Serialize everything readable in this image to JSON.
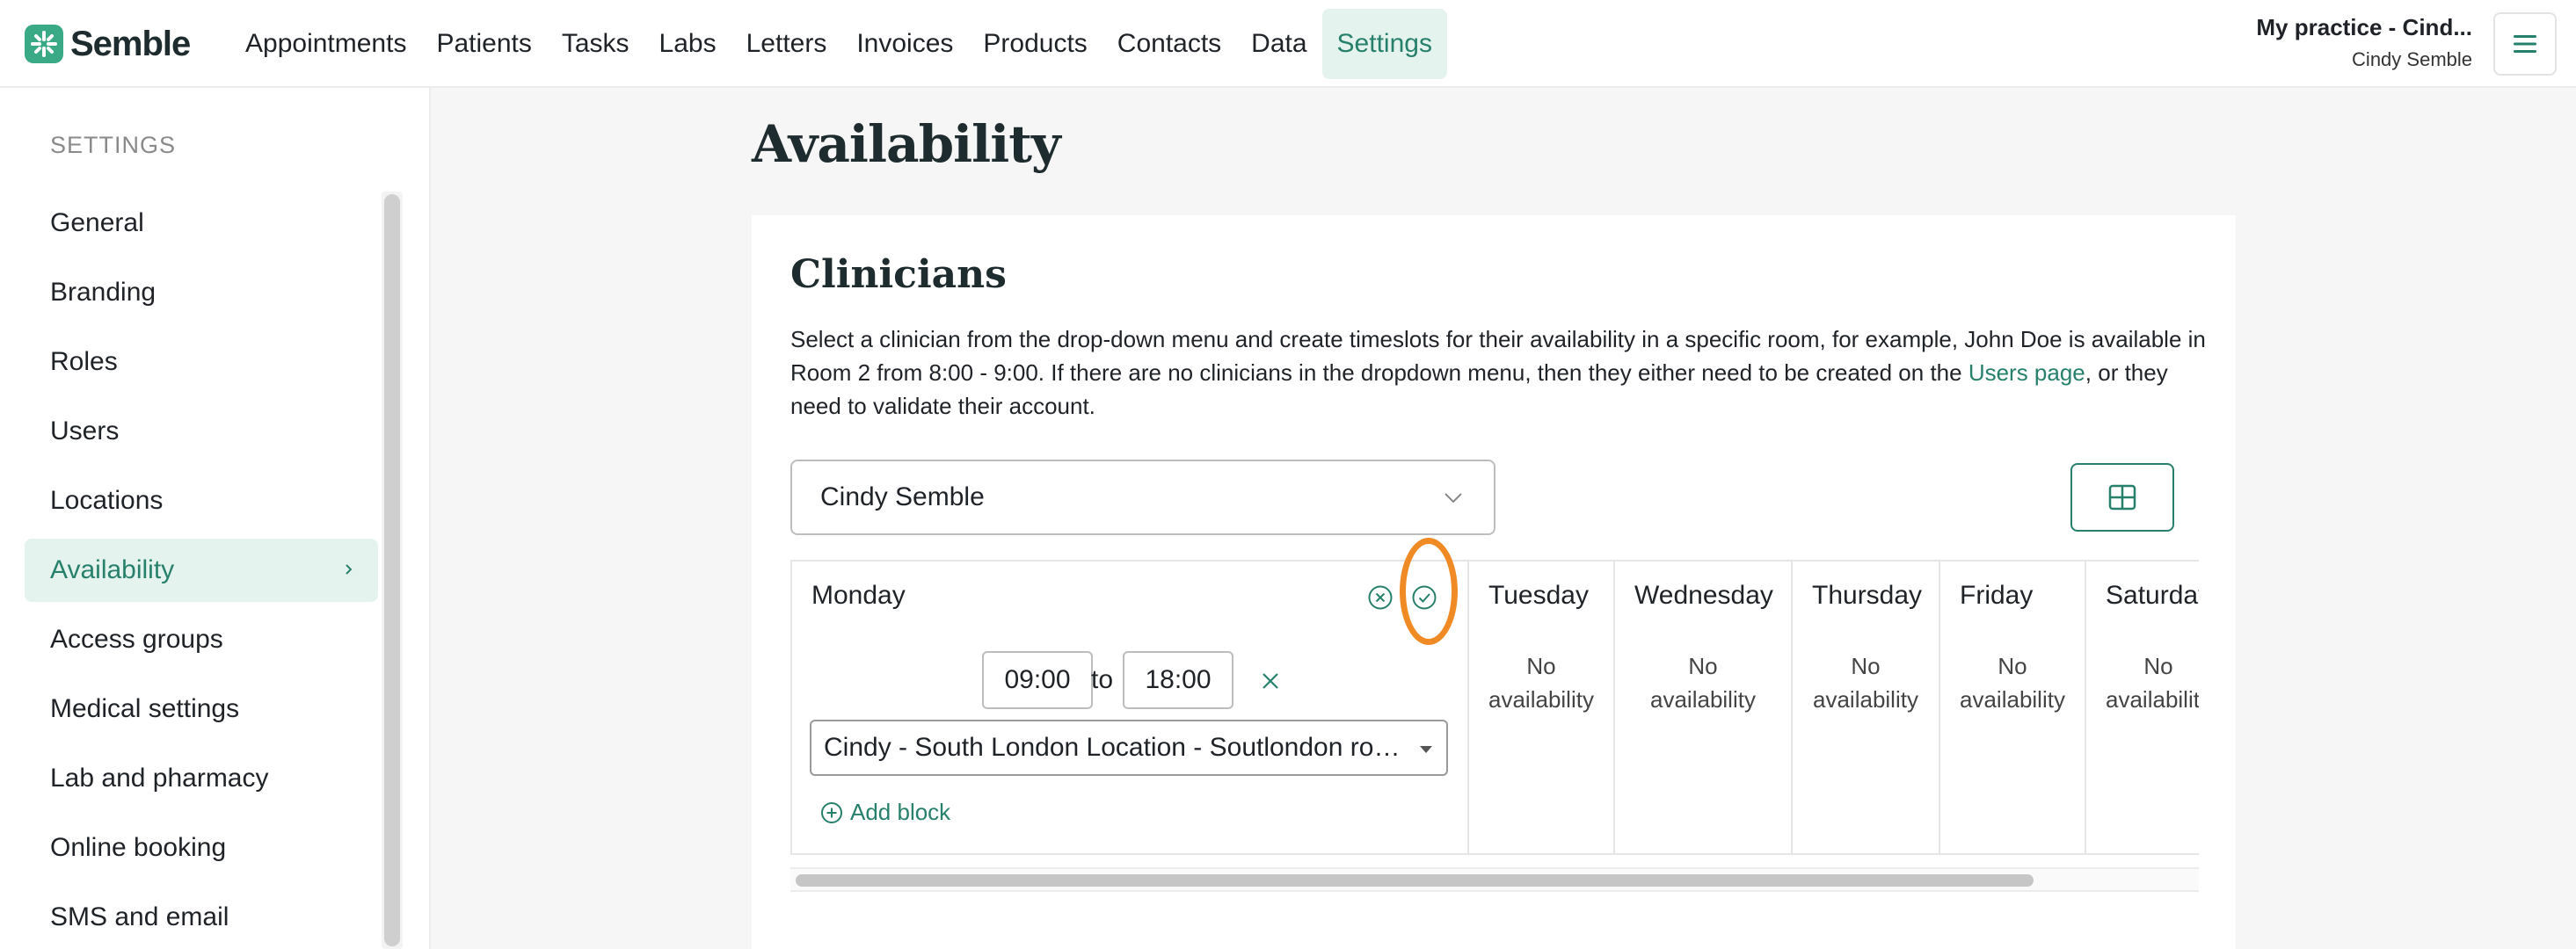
{
  "brand": {
    "name": "Semble",
    "color": "#3aa986"
  },
  "nav": {
    "items": [
      {
        "label": "Appointments"
      },
      {
        "label": "Patients"
      },
      {
        "label": "Tasks"
      },
      {
        "label": "Labs"
      },
      {
        "label": "Letters"
      },
      {
        "label": "Invoices"
      },
      {
        "label": "Products"
      },
      {
        "label": "Contacts"
      },
      {
        "label": "Data"
      },
      {
        "label": "Settings",
        "active": true
      }
    ]
  },
  "account": {
    "practice": "My practice - Cind...",
    "user": "Cindy Semble"
  },
  "sidebar": {
    "heading": "SETTINGS",
    "items": [
      {
        "label": "General"
      },
      {
        "label": "Branding"
      },
      {
        "label": "Roles"
      },
      {
        "label": "Users"
      },
      {
        "label": "Locations"
      },
      {
        "label": "Availability",
        "active": true
      },
      {
        "label": "Access groups"
      },
      {
        "label": "Medical settings"
      },
      {
        "label": "Lab and pharmacy"
      },
      {
        "label": "Online booking"
      },
      {
        "label": "SMS and email"
      }
    ]
  },
  "page": {
    "title": "Availability"
  },
  "clinicians": {
    "title": "Clinicians",
    "description_before": "Select a clinician from the drop-down menu and create timeslots for their availability in a specific room, for example, John Doe is available in Room 2 from 8:00 - 9:00. If there are no clinicians in the dropdown menu, then they either need to be created on the ",
    "description_link": "Users page",
    "description_after": ", or they need to validate their account.",
    "selected_clinician": "Cindy Semble"
  },
  "schedule": {
    "monday": {
      "name": "Monday",
      "start": "09:00",
      "to_label": "to",
      "end": "18:00",
      "location": "Cindy - South London Location - Soutlondon room",
      "add_block_label": "Add block"
    },
    "other_days": [
      {
        "name": "Tuesday",
        "line1": "No",
        "line2": "availability"
      },
      {
        "name": "Wednesday",
        "line1": "No",
        "line2": "availability"
      },
      {
        "name": "Thursday",
        "line1": "No",
        "line2": "availability"
      },
      {
        "name": "Friday",
        "line1": "No",
        "line2": "availability"
      },
      {
        "name": "Saturday",
        "line1": "No",
        "line2": "availability"
      }
    ]
  },
  "colors": {
    "accent": "#27806b",
    "accent_bg": "#e5f3ee",
    "highlight": "#f08a24"
  }
}
